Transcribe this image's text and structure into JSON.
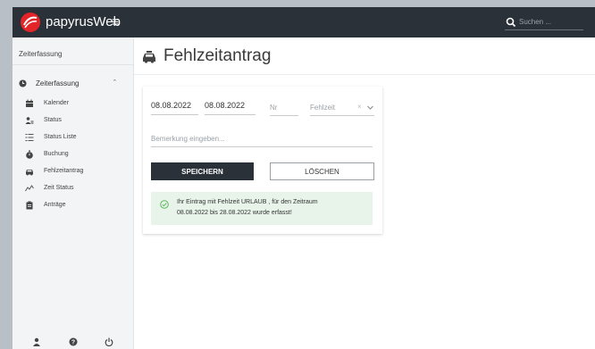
{
  "app": {
    "name": "papyrusWeb",
    "accent": "#e3252a",
    "topbar_color": "#2a3138"
  },
  "search": {
    "placeholder": "Suchen ..."
  },
  "sidebar": {
    "heading": "Zeiterfassung",
    "group": {
      "label": "Zeiterfassung",
      "icon": "clock-icon",
      "expanded": true
    },
    "items": [
      {
        "label": "Kalender",
        "icon": "calendar-icon"
      },
      {
        "label": "Status",
        "icon": "users-icon"
      },
      {
        "label": "Status Liste",
        "icon": "list-icon"
      },
      {
        "label": "Buchung",
        "icon": "stopwatch-icon"
      },
      {
        "label": "Fehlzeitantrag",
        "icon": "car-icon"
      },
      {
        "label": "Zeit Status",
        "icon": "chart-icon"
      },
      {
        "label": "Anträge",
        "icon": "clipboard-icon"
      }
    ],
    "footer_icons": [
      "user-icon",
      "help-icon",
      "power-icon"
    ]
  },
  "page": {
    "title": "Fehlzeitantrag",
    "title_icon": "car-icon"
  },
  "form": {
    "date_from": "08.08.2022",
    "date_to": "08.08.2022",
    "nr_placeholder": "Nr",
    "absence_placeholder": "Fehlzeit",
    "note_placeholder": "Bemerkung eingeben...",
    "save_label": "SPEICHERN",
    "delete_label": "LÖSCHEN"
  },
  "alert": {
    "line1": "Ihr Eintrag mit Fehlzeit URLAUB , für den Zeitraum",
    "line2": "08.08.2022 bis 28.08.2022 wurde erfasst!",
    "color": "#e8f4ea",
    "icon_color": "#5cb85c"
  }
}
